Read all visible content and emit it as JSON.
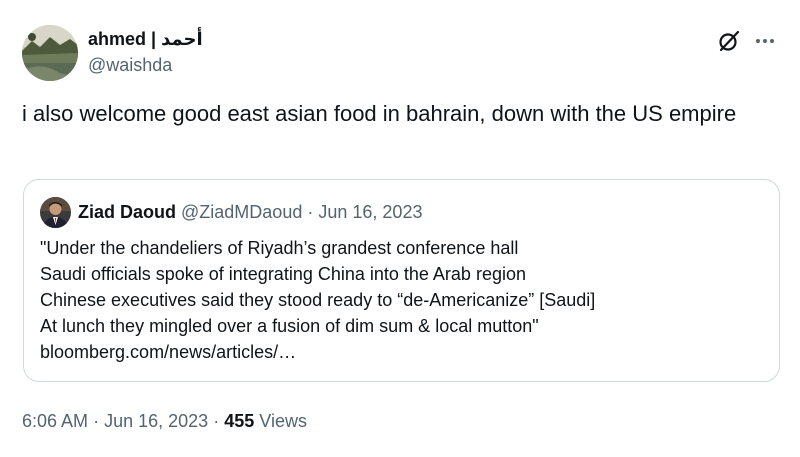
{
  "tweet": {
    "author": {
      "display_name": "ahmed | أحمد",
      "handle": "@waishda"
    },
    "text": "i also welcome good east asian food in bahrain, down with the US empire",
    "quoted": {
      "author_name": "Ziad Daoud",
      "author_handle": "@ZiadMDaoud",
      "separator": "·",
      "date": "Jun 16, 2023",
      "lines": [
        "\"Under the chandeliers of Riyadh’s grandest conference hall",
        "Saudi officials spoke of integrating China into the Arab region",
        "Chinese executives said they stood ready to “de-Americanize” [Saudi]",
        "At lunch they mingled over a fusion of dim sum & local mutton\"",
        "bloomberg.com/news/articles/…"
      ]
    },
    "footer": {
      "time": "6:06 AM",
      "dot1": "·",
      "date": "Jun 16, 2023",
      "dot2": "·",
      "views_count": "455",
      "views_label": "Views"
    },
    "icons": {
      "grok": "grok-icon",
      "more": "more-icon"
    },
    "colors": {
      "text": "#0f1419",
      "muted": "#536471",
      "border": "#cfd9de"
    }
  }
}
